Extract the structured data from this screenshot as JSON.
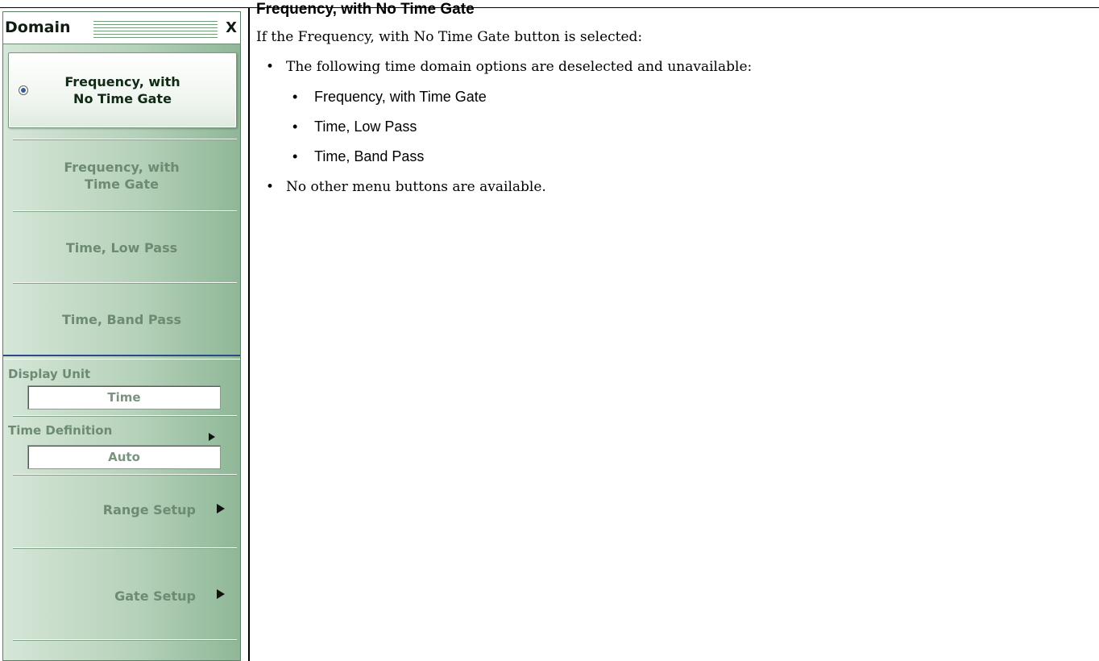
{
  "menu": {
    "title": "Domain",
    "close_label": "X",
    "buttons": [
      {
        "label": "Frequency, with\nNo Time Gate",
        "selected": true
      },
      {
        "label": "Frequency, with\nTime Gate",
        "selected": false
      },
      {
        "label": "Time, Low Pass",
        "selected": false
      },
      {
        "label": "Time, Band Pass",
        "selected": false
      }
    ],
    "display_unit": {
      "label": "Display Unit",
      "value": "Time"
    },
    "time_definition": {
      "label": "Time Definition",
      "value": "Auto"
    },
    "range_setup": "Range Setup",
    "gate_setup": "Gate Setup",
    "colors": {
      "panel_green": "#a9c9b0",
      "disabled_text": "#6c8b72",
      "separator_blue": "#2b4a8a"
    }
  },
  "doc": {
    "heading": "Frequency, with No Time Gate",
    "intro": "If the Frequency, with No Time Gate button is selected:",
    "bullet_char": "•",
    "bullets": [
      "The following time domain options are deselected and unavailable:",
      "No other menu buttons are available."
    ],
    "sub_bullets": [
      "Frequency, with Time Gate",
      "Time, Low Pass",
      "Time, Band Pass"
    ]
  }
}
